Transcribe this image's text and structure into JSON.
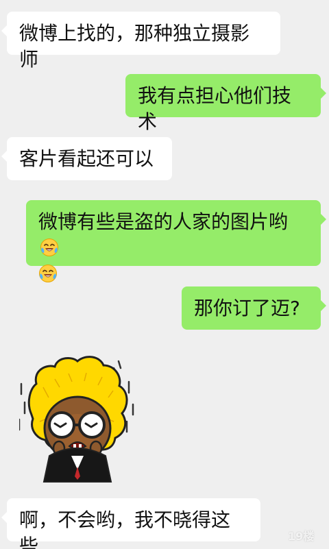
{
  "messages": [
    {
      "side": "left",
      "text": "微博上找的，那种独立摄影师"
    },
    {
      "side": "right",
      "text": "我有点担心他们技术"
    },
    {
      "side": "left",
      "text": "客片看起还可以"
    },
    {
      "side": "right",
      "text": "微博有些是盗的人家的图片哟",
      "emoji": [
        "crying-laughing-emoji",
        "crying-laughing-emoji"
      ]
    },
    {
      "side": "right",
      "text": "那你订了迈?"
    },
    {
      "side": "left",
      "type": "sticker",
      "sticker_name": "shivering-cartoon-sticker"
    },
    {
      "side": "left",
      "text": "啊，不会哟，我不晓得这些"
    }
  ],
  "watermark": {
    "text": "19楼"
  },
  "colors": {
    "background": "#efefef",
    "incoming_bubble": "#ffffff",
    "outgoing_bubble": "#95ec69"
  }
}
